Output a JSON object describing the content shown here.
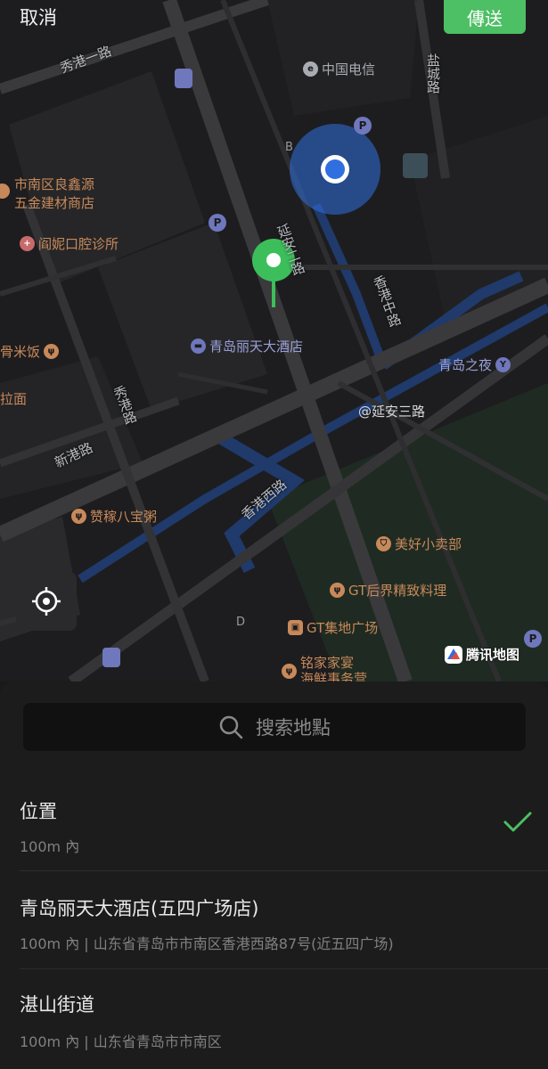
{
  "topbar": {
    "cancel_label": "取消",
    "send_label": "傳送"
  },
  "map": {
    "road_labels": {
      "xiugang_1": "秀港一路",
      "yancheng": "盐城路",
      "yanan_2": "延安二路",
      "xianggang_zhong": "香港中路",
      "xiugang": "秀港路",
      "xingang": "新港路",
      "xianggang_xi": "香港西路"
    },
    "pois": {
      "china_telecom": "中国电信",
      "liangxinyuan_1": "市南区良鑫源",
      "liangxinyuan_2": "五金建材商店",
      "dental": "阎妮口腔诊所",
      "gumifan": "骨米饭",
      "lamian": "拉面",
      "hotel": "青岛丽天大酒店",
      "night": "青岛之夜",
      "yanan_3": "@延安三路",
      "zanjia": "赞稼八宝粥",
      "meihao": "美好小卖部",
      "gt_restaurant": "GT后界精致料理",
      "gt_plaza": "GT集地广场",
      "mingjia_1": "铭家家宴",
      "mingjia_2": "海鲜事务营"
    },
    "letters": {
      "b": "B",
      "d": "D"
    },
    "parking": "P",
    "brand": "腾讯地图",
    "colors": {
      "pin": "#3cbf5a",
      "my_location": "#2f6fe0",
      "water": "#1f3a6b",
      "green_area": "#1f2b22"
    }
  },
  "sheet": {
    "search_placeholder": "搜索地點",
    "items": [
      {
        "title": "位置",
        "sub": "100m 內",
        "selected": true
      },
      {
        "title": "青岛丽天大酒店(五四广场店)",
        "sub": "100m 內 | 山东省青岛市市南区香港西路87号(近五四广场)"
      },
      {
        "title": "湛山街道",
        "sub": "100m 內 | 山东省青岛市市南区"
      }
    ]
  }
}
